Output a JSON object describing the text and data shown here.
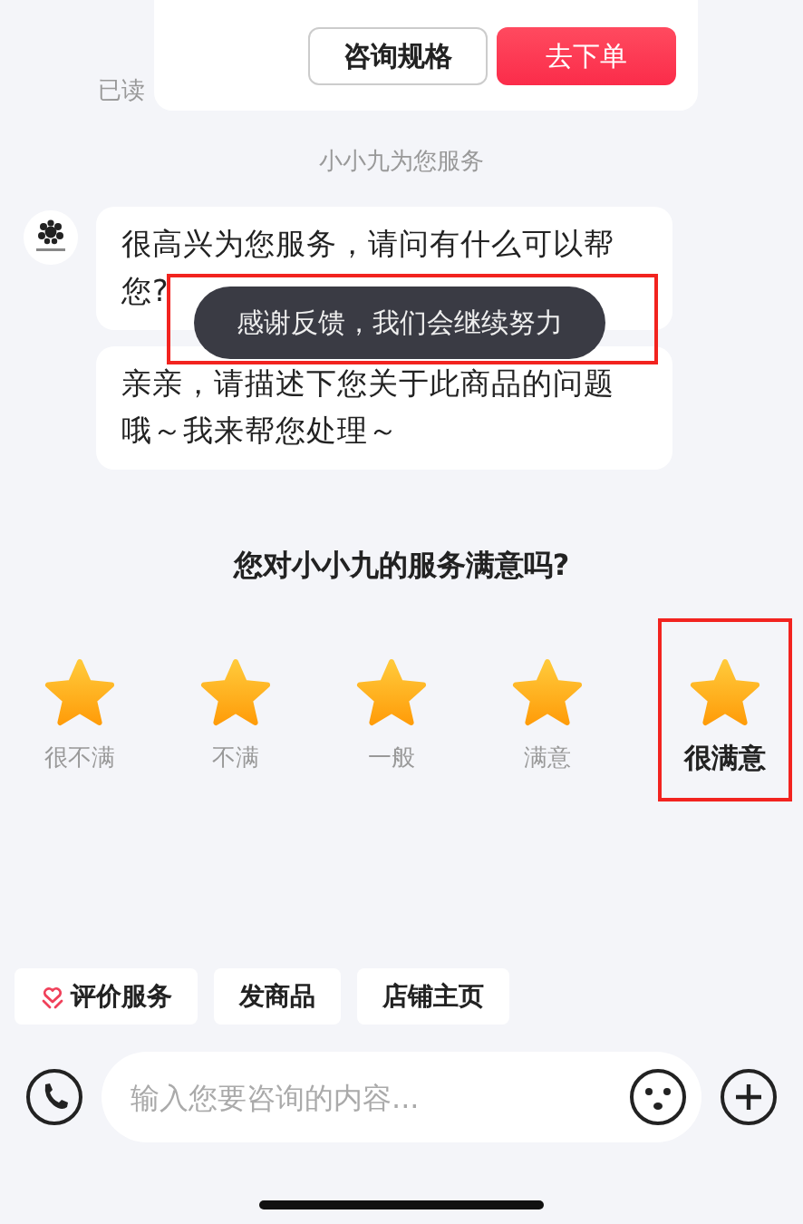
{
  "product_card": {
    "buttons": [
      {
        "label": "咨询规格",
        "kind": "outline"
      },
      {
        "label": "去下单",
        "kind": "primary"
      }
    ]
  },
  "read_status": "已读",
  "system_notice": "小小九为您服务",
  "messages": [
    {
      "text": "很高兴为您服务，请问有什么可以帮您?"
    },
    {
      "text": "亲亲，请描述下您关于此商品的问题哦～我来帮您处理～"
    }
  ],
  "toast": {
    "text": "感谢反馈，我们会继续努力",
    "highlighted": true
  },
  "rating": {
    "question": "您对小小九的服务满意吗?",
    "options": [
      {
        "label": "很不满",
        "selected": false
      },
      {
        "label": "不满",
        "selected": false
      },
      {
        "label": "一般",
        "selected": false
      },
      {
        "label": "满意",
        "selected": false
      },
      {
        "label": "很满意",
        "selected": true
      }
    ]
  },
  "quick_actions": [
    {
      "label": "评价服务",
      "kind": "heart"
    },
    {
      "label": "发商品",
      "kind": "plain"
    },
    {
      "label": "店铺主页",
      "kind": "plain"
    }
  ],
  "input": {
    "placeholder": "输入您要咨询的内容..."
  }
}
